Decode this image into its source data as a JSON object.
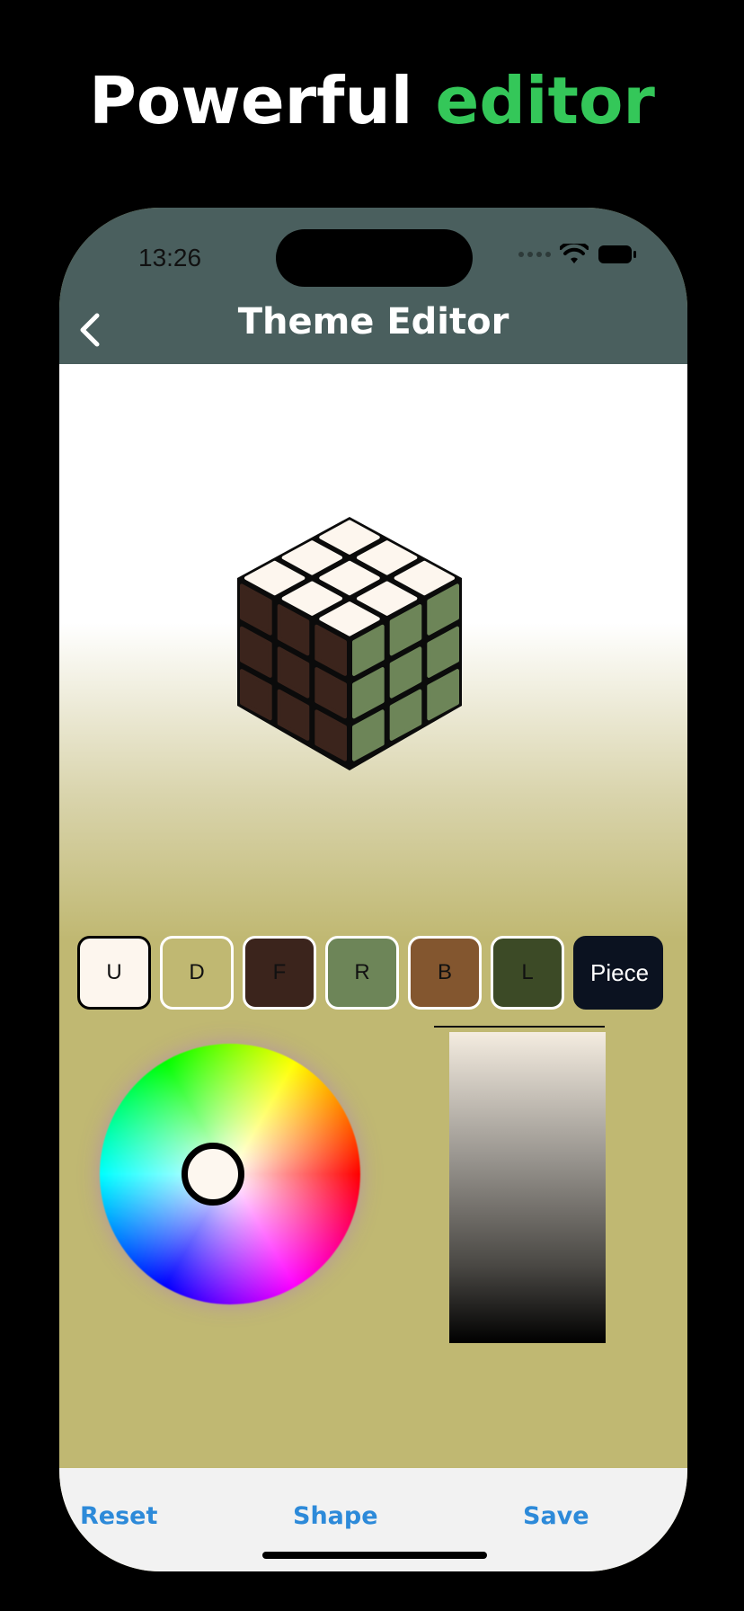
{
  "headline": {
    "part1": "Powerful ",
    "part2": "editor"
  },
  "status": {
    "time": "13:26"
  },
  "nav": {
    "title": "Theme Editor"
  },
  "swatches": [
    {
      "label": "U",
      "color": "#fdf6ee",
      "selected": true
    },
    {
      "label": "D",
      "color": "#c0b872",
      "selected": false
    },
    {
      "label": "F",
      "color": "#3b241c",
      "selected": false
    },
    {
      "label": "R",
      "color": "#6d8558",
      "selected": false
    },
    {
      "label": "B",
      "color": "#83562f",
      "selected": false
    },
    {
      "label": "L",
      "color": "#3c4a26",
      "selected": false
    },
    {
      "label": "Piece",
      "color": "#0b1220",
      "selected": false
    }
  ],
  "toolbar": {
    "reset": "Reset",
    "shape": "Shape",
    "save": "Save"
  },
  "colors": {
    "accent": "#34c759",
    "navbar": "#4a5f5e",
    "background": "#c0b872",
    "link": "#2d8ad9"
  }
}
